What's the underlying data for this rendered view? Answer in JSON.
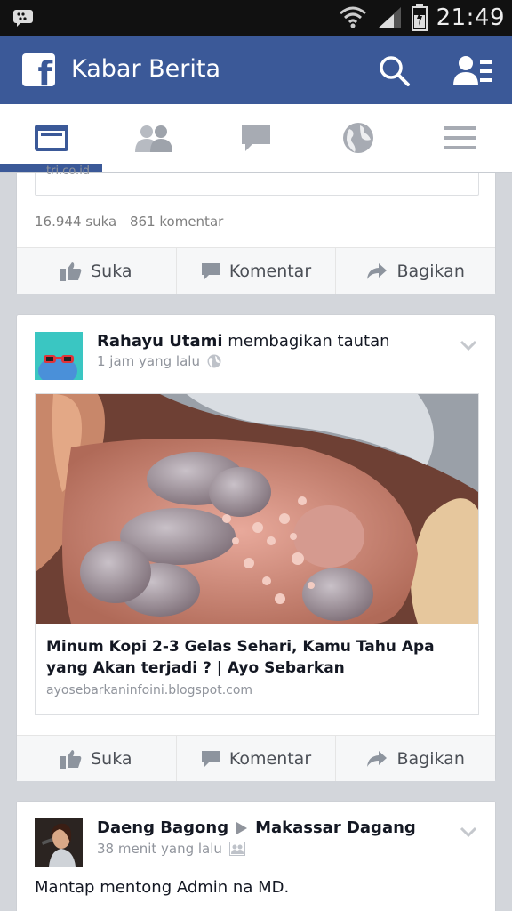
{
  "status_bar": {
    "time": "21:49",
    "icons": [
      "bbm-icon",
      "wifi-icon",
      "signal-icon",
      "battery-charging-icon"
    ]
  },
  "header": {
    "title": "Kabar Berita",
    "logo_letter": "f",
    "brand_color": "#3b5998"
  },
  "tabs": [
    {
      "name": "news-feed",
      "icon": "news-feed-icon",
      "active": true
    },
    {
      "name": "friend-requests",
      "icon": "friends-icon",
      "active": false
    },
    {
      "name": "messages",
      "icon": "chat-icon",
      "active": false
    },
    {
      "name": "notifications",
      "icon": "globe-icon",
      "active": false
    },
    {
      "name": "more",
      "icon": "menu-icon",
      "active": false
    }
  ],
  "post1": {
    "link_domain_partial": "tri.co.id",
    "likes": "16.944 suka",
    "comments": "861 komentar",
    "actions": {
      "like": "Suka",
      "comment": "Komentar",
      "share": "Bagikan"
    }
  },
  "post2": {
    "author": "Rahayu Utami",
    "verb": "membagikan tautan",
    "time": "1 jam yang lalu",
    "privacy_icon": "globe-icon",
    "link_title": "Minum Kopi 2-3 Gelas Sehari, Kamu Tahu Apa yang Akan terjadi ? | Ayo Sebarkan",
    "link_domain": "ayosebarkaninfoini.blogspot.com",
    "actions": {
      "like": "Suka",
      "comment": "Komentar",
      "share": "Bagikan"
    }
  },
  "post3": {
    "author": "Daeng Bagong",
    "target": "Makassar Dagang",
    "time": "38 menit yang lalu",
    "privacy_icon": "group-icon",
    "text": "Mantap mentong Admin na MD."
  }
}
